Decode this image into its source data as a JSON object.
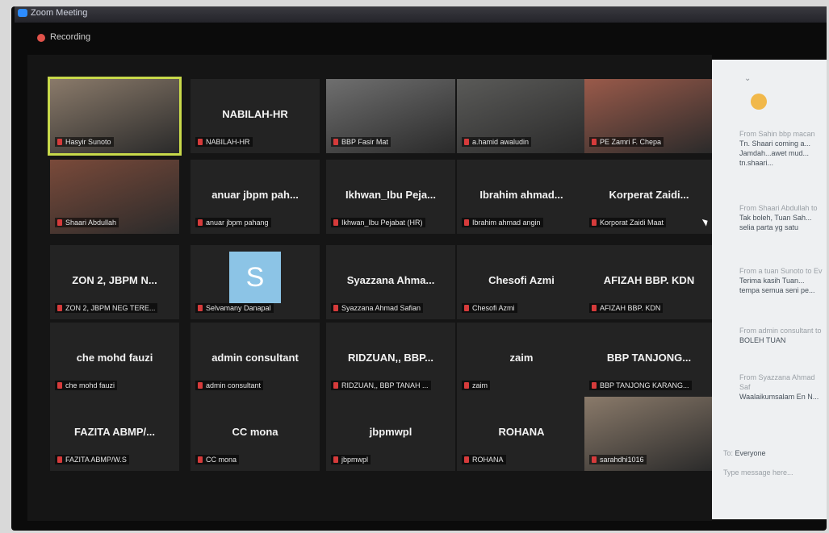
{
  "window": {
    "title": "Zoom Meeting"
  },
  "recording": {
    "label": "Recording"
  },
  "tiles": [
    {
      "name": "",
      "label": "Hasyir Sunoto",
      "kind": "video"
    },
    {
      "name": "NABILAH-HR",
      "label": "NABILAH-HR",
      "kind": "name"
    },
    {
      "name": "",
      "label": "BBP Fasir Mat",
      "kind": "video"
    },
    {
      "name": "",
      "label": "a.hamid awaludin",
      "kind": "video"
    },
    {
      "name": "",
      "label": "PE Zamri F. Chepa",
      "kind": "video"
    },
    {
      "name": "",
      "label": "Shaari Abdullah",
      "kind": "video"
    },
    {
      "name": "anuar jbpm pah...",
      "label": "anuar jbpm pahang",
      "kind": "name"
    },
    {
      "name": "Ikhwan_Ibu Peja...",
      "label": "Ikhwan_Ibu Pejabat (HR)",
      "kind": "name"
    },
    {
      "name": "Ibrahim ahmad...",
      "label": "Ibrahim ahmad angin",
      "kind": "name"
    },
    {
      "name": "Korperat Zaidi...",
      "label": "Korporat Zaidi Maat",
      "kind": "name"
    },
    {
      "name": "ZON 2, JBPM N...",
      "label": "ZON 2, JBPM NEG TERE...",
      "kind": "name"
    },
    {
      "name": "S",
      "label": "Selvamany Danapal",
      "kind": "avatar"
    },
    {
      "name": "Syazzana Ahma...",
      "label": "Syazzana Ahmad Safian",
      "kind": "name"
    },
    {
      "name": "Chesofi Azmi",
      "label": "Chesofi Azmi",
      "kind": "name"
    },
    {
      "name": "AFIZAH BBP. KDN",
      "label": "AFIZAH BBP. KDN",
      "kind": "name"
    },
    {
      "name": "che mohd fauzi",
      "label": "che mohd fauzi",
      "kind": "name"
    },
    {
      "name": "admin consultant",
      "label": "admin consultant",
      "kind": "name"
    },
    {
      "name": "RIDZUAN,, BBP...",
      "label": "RIDZUAN,, BBP TANAH ...",
      "kind": "name"
    },
    {
      "name": "zaim",
      "label": "zaim",
      "kind": "name"
    },
    {
      "name": "BBP TANJONG...",
      "label": "BBP TANJONG KARANG...",
      "kind": "name"
    },
    {
      "name": "FAZITA ABMP/...",
      "label": "FAZITA ABMP/W.S",
      "kind": "name"
    },
    {
      "name": "CC mona",
      "label": "CC mona",
      "kind": "name"
    },
    {
      "name": "jbpmwpl",
      "label": "jbpmwpl",
      "kind": "name"
    },
    {
      "name": "ROHANA",
      "label": "ROHANA",
      "kind": "name"
    },
    {
      "name": "",
      "label": "sarahdhi1016",
      "kind": "video"
    }
  ],
  "chat": {
    "messages": [
      {
        "from": "From Sahin bbp macan",
        "text": "Tn. Shaari coming a... Jamdah...awet mud... tn.shaari..."
      },
      {
        "from": "From Shaari Abdullah to",
        "text": "Tak boleh, Tuan Sah... selia parta yg satu"
      },
      {
        "from": "From a tuan Sunoto to Ev",
        "text": "Terima kasih Tuan... tempa semua seni pe..."
      },
      {
        "from": "From admin consultant to",
        "text": "BOLEH TUAN"
      },
      {
        "from": "From Syazzana Ahmad Saf",
        "text": "Waalaikumsalam En N..."
      }
    ],
    "to_label": "To:",
    "to_value": "Everyone",
    "placeholder": "Type message here..."
  }
}
